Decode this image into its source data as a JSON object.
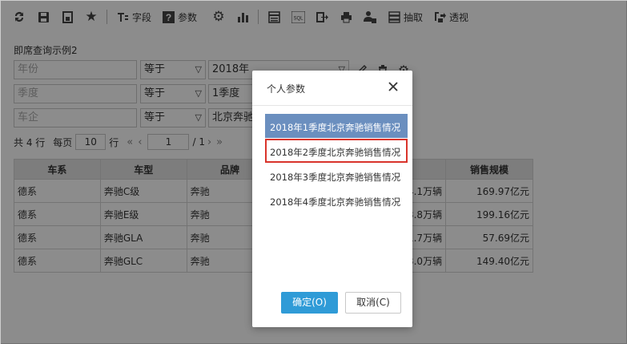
{
  "toolbar": {
    "field_label": "字段",
    "param_label": "参数",
    "sql_label": "SQL",
    "extract_label": "抽取",
    "pivot_label": "透视"
  },
  "query": {
    "title": "即席查询示例2",
    "rows": [
      {
        "field": "年份",
        "op": "等于",
        "value": "2018年"
      },
      {
        "field": "季度",
        "op": "等于",
        "value": "1季度"
      },
      {
        "field": "车企",
        "op": "等于",
        "value": "北京奔驰"
      }
    ]
  },
  "pager": {
    "total_text": "共 4 行",
    "per_page_label": "每页",
    "per_page_value": "10",
    "row_unit": "行",
    "first": "«",
    "prev": "‹",
    "page_value": "1",
    "page_total": "/ 1",
    "next": "›",
    "last": "»"
  },
  "table": {
    "headers": [
      "车系",
      "车型",
      "品牌",
      "",
      "",
      "销售规模"
    ],
    "rows": [
      [
        "德系",
        "奔驰C级",
        "奔驰",
        "",
        "4.1万辆",
        "169.97亿元"
      ],
      [
        "德系",
        "奔驰E级",
        "奔驰",
        "",
        "3.8万辆",
        "199.16亿元"
      ],
      [
        "德系",
        "奔驰GLA",
        "奔驰",
        "",
        "1.7万辆",
        "57.69亿元"
      ],
      [
        "德系",
        "奔驰GLC",
        "奔驰",
        "",
        "3.0万辆",
        "149.40亿元"
      ]
    ]
  },
  "modal": {
    "title": "个人参数",
    "items": [
      "2018年1季度北京奔驰销售情况",
      "2018年2季度北京奔驰销售情况",
      "2018年3季度北京奔驰销售情况",
      "2018年4季度北京奔驰销售情况"
    ],
    "ok_label": "确定(O)",
    "cancel_label": "取消(C)"
  },
  "colors": {
    "selected_item": "#6b8fbf",
    "highlight_border": "#d9342b",
    "ok_button": "#2f9bd7"
  }
}
